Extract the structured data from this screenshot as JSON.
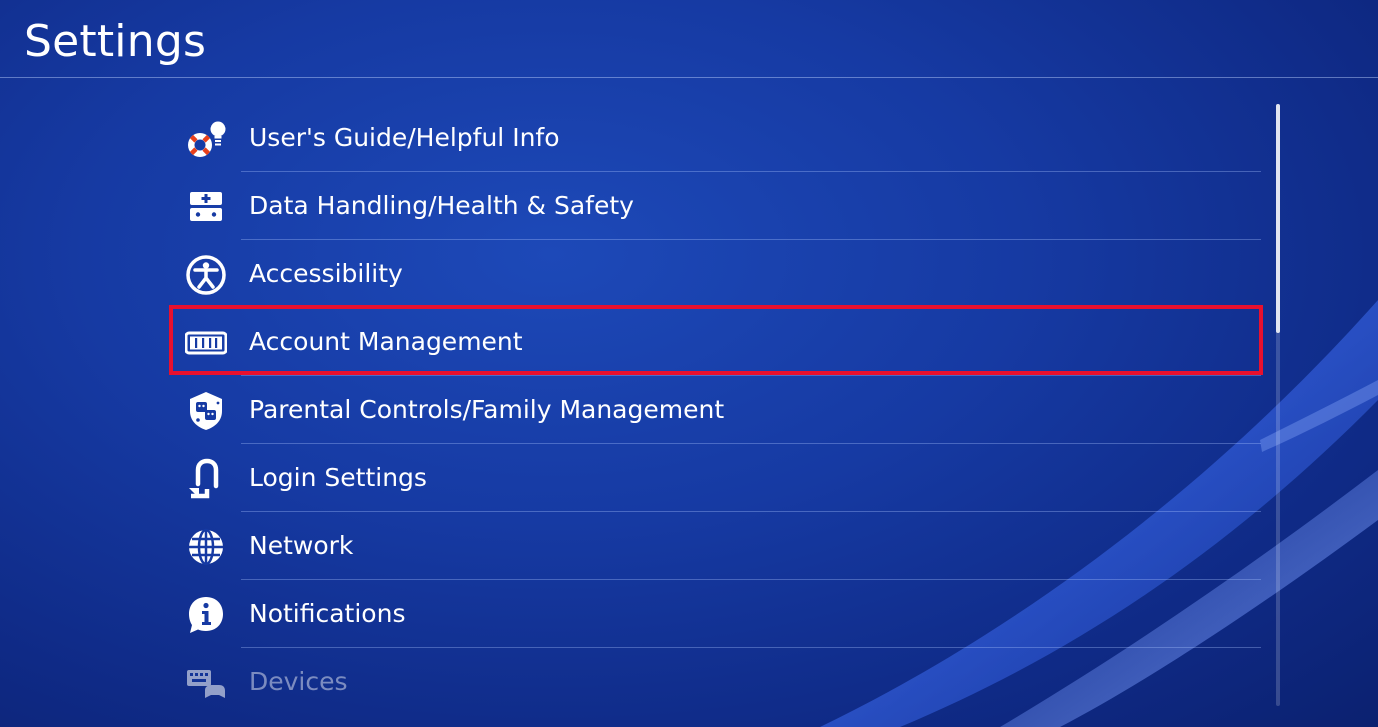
{
  "header": {
    "title": "Settings"
  },
  "menu": {
    "items": [
      {
        "label": "User's Guide/Helpful Info",
        "icon": "lifebuoy-lightbulb-icon"
      },
      {
        "label": "Data Handling/Health & Safety",
        "icon": "medical-kit-icon"
      },
      {
        "label": "Accessibility",
        "icon": "accessibility-icon"
      },
      {
        "label": "Account Management",
        "icon": "id-card-icon"
      },
      {
        "label": "Parental Controls/Family Management",
        "icon": "family-shield-icon"
      },
      {
        "label": "Login Settings",
        "icon": "login-arrow-icon"
      },
      {
        "label": "Network",
        "icon": "globe-icon"
      },
      {
        "label": "Notifications",
        "icon": "info-bubble-icon"
      },
      {
        "label": "Devices",
        "icon": "keyboard-controller-icon"
      }
    ],
    "selected_index": 3
  },
  "colors": {
    "background": "#163aa3",
    "highlight": "#e8102e",
    "text": "#ffffff"
  },
  "scrollbar": {
    "position_fraction": 0.0,
    "visible_fraction": 0.38
  }
}
